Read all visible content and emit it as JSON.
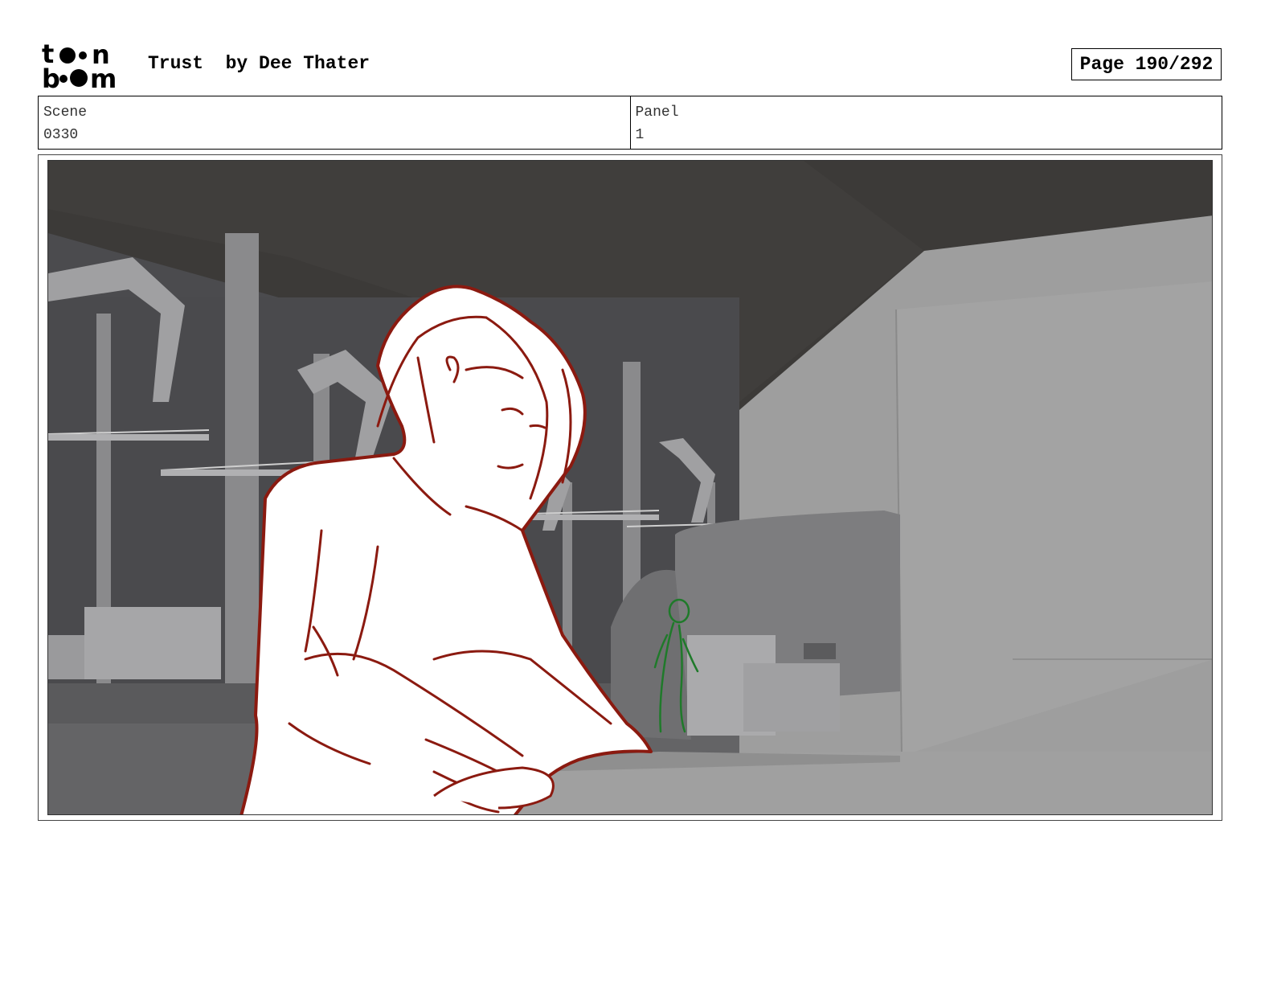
{
  "header": {
    "logo_text": "toon boom",
    "title": "Trust  by Dee Thater",
    "page": "Page 190/292"
  },
  "info": {
    "scene_label": "Scene",
    "scene_value": "0330",
    "panel_label": "Panel",
    "panel_value": "1"
  },
  "colors": {
    "sketch_red": "#8b1a10",
    "sketch_green": "#1f7a2a",
    "ceiling": "#3a3836",
    "wall_light": "#9c9c9c"
  }
}
